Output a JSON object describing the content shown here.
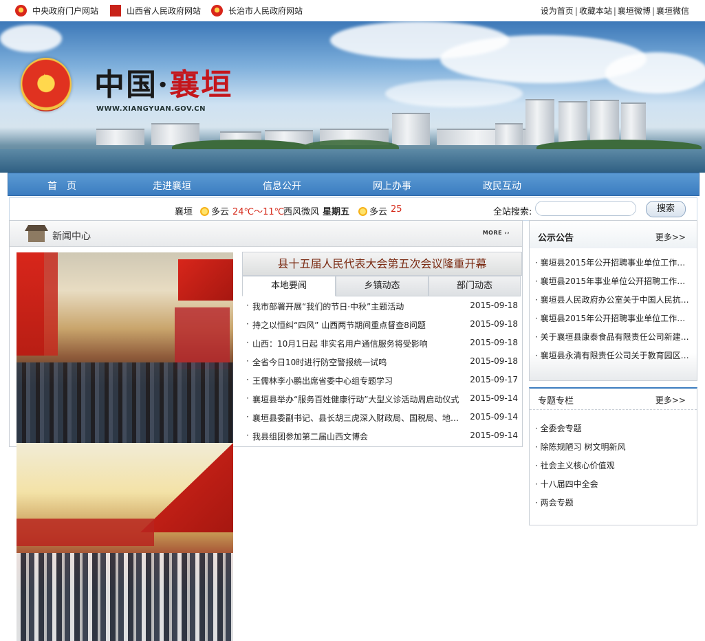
{
  "topbar": {
    "links_left": [
      "中央政府门户网站",
      "山西省人民政府网站",
      "长治市人民政府网站"
    ],
    "links_right": [
      "设为首页",
      "收藏本站",
      "襄垣微博",
      "襄垣微信"
    ],
    "separator": "|"
  },
  "banner": {
    "title_part1": "中国·",
    "title_part2": "襄垣",
    "url": "WWW.XIANGYUAN.GOV.CN"
  },
  "nav": [
    "首　页",
    "走进襄垣",
    "信息公开",
    "网上办事",
    "政民互动"
  ],
  "weather": {
    "city": "襄垣",
    "today_cond": "多云",
    "today_temp": "24℃～11℃",
    "wind": "西风微风",
    "next_day": "星期五",
    "next_cond": "多云",
    "next_temp": "25"
  },
  "search": {
    "label": "全站搜索:",
    "placeholder": "",
    "button": "搜索"
  },
  "news_center": {
    "title": "新闻中心",
    "more": "MORE",
    "headline": "县十五届人民代表大会第五次会议隆重开幕",
    "tabs": [
      "本地要闻",
      "乡镇动态",
      "部门动态"
    ],
    "active_tab": 0,
    "items": [
      {
        "title": "我市部署开展“我们的节日·中秋”主题活动",
        "date": "2015-09-18"
      },
      {
        "title": "持之以恒纠“四风” 山西两节期间重点督查8问题",
        "date": "2015-09-18"
      },
      {
        "title": "山西：10月1日起 非实名用户通信服务将受影响",
        "date": "2015-09-18"
      },
      {
        "title": "全省今日10时进行防空警报统一试鸣",
        "date": "2015-09-18"
      },
      {
        "title": "王儒林李小鹏出席省委中心组专题学习",
        "date": "2015-09-17"
      },
      {
        "title": "襄垣县举办“服务百姓健康行动”大型义诊活动周启动仪式",
        "date": "2015-09-14"
      },
      {
        "title": "襄垣县委副书记、县长胡三虎深入财政局、国税局、地…",
        "date": "2015-09-14"
      },
      {
        "title": "我县组团参加第二届山西文博会",
        "date": "2015-09-14"
      }
    ]
  },
  "notices": {
    "title": "公示公告",
    "more": "更多>>",
    "items": [
      "襄垣县2015年公开招聘事业单位工作人…",
      "襄垣县2015年事业单位公开招聘工作人…",
      "襄垣县人民政府办公室关于中国人民抗…",
      "襄垣县2015年公开招聘事业单位工作人…",
      "关于襄垣县康泰食品有限责任公司新建…",
      "襄垣县永清有限责任公司关于教育园区…"
    ]
  },
  "topics": {
    "title": "专题专栏",
    "more": "更多>>",
    "items": [
      "全委会专题",
      "除陈规陋习 树文明新风",
      "社会主义核心价值观",
      "十八届四中全会",
      "两会专题"
    ]
  },
  "colors": {
    "nav_blue": "#3b7cc0",
    "red_accent": "#c4161c",
    "headline_text": "#7a2a12"
  }
}
